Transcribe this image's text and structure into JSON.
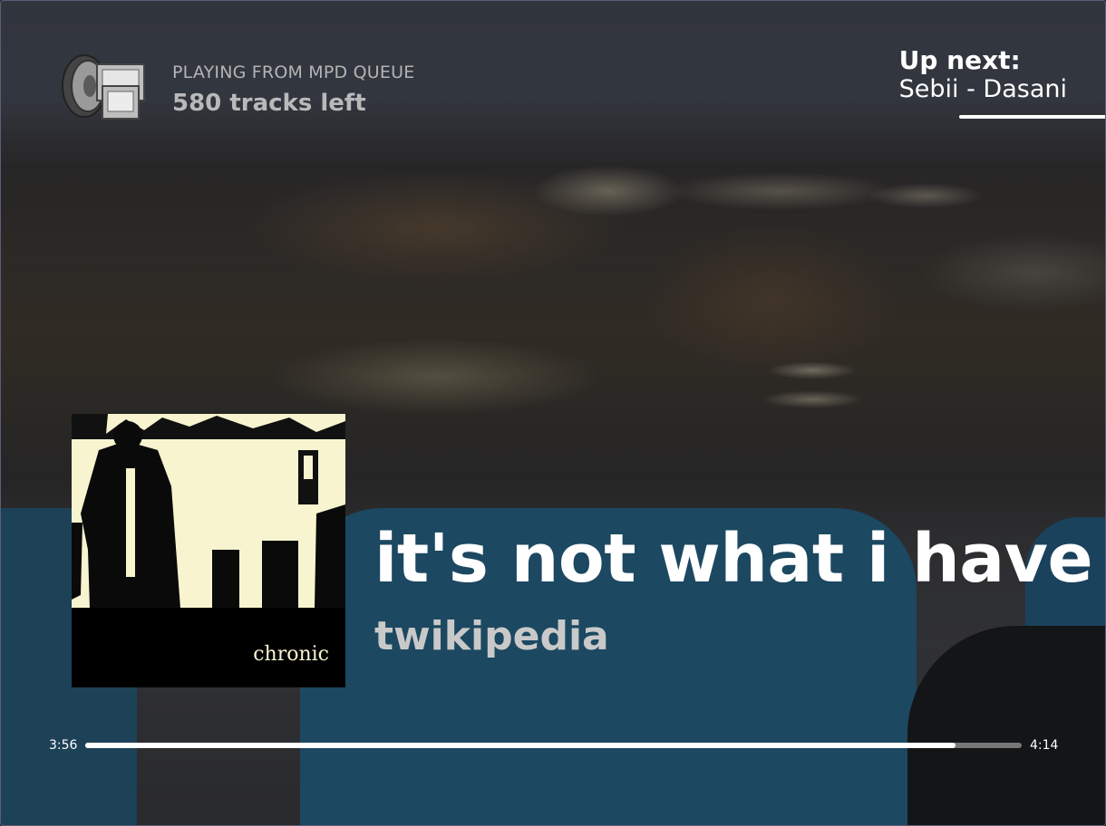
{
  "queue": {
    "source_label": "PLAYING FROM MPD QUEUE",
    "tracks_left": "580 tracks left"
  },
  "up_next": {
    "title": "Up next:",
    "track": "Sebii - Dasani"
  },
  "now_playing": {
    "title": "it's not what i have",
    "artist": "twikipedia",
    "album_cover_text": "chronic"
  },
  "progress": {
    "elapsed": "3:56",
    "total": "4:14",
    "fraction": 0.929
  },
  "icons": {
    "queue": "speaker-computer-icon"
  }
}
